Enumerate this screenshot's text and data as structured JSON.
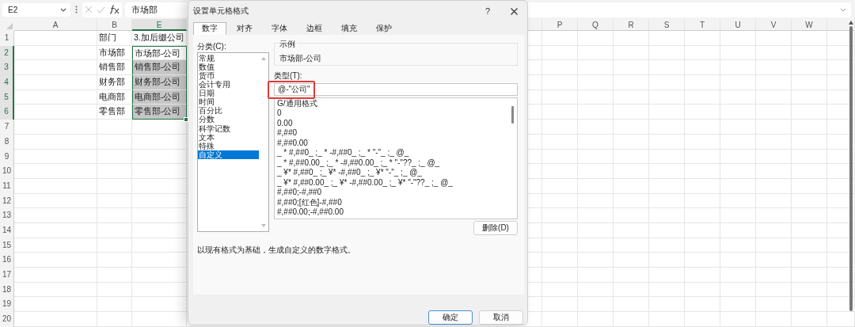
{
  "formula_bar": {
    "name_box": "E2",
    "formula": "市场部"
  },
  "sheet": {
    "columns_left": [
      {
        "label": "A",
        "selected": false
      },
      {
        "label": "B",
        "selected": false
      },
      {
        "label": "E",
        "selected": true
      }
    ],
    "columns_right": [
      {
        "label": "P",
        "selected": false
      },
      {
        "label": "Q",
        "selected": false
      },
      {
        "label": "R",
        "selected": false
      },
      {
        "label": "S",
        "selected": false
      },
      {
        "label": "T",
        "selected": false
      },
      {
        "label": "U",
        "selected": false
      },
      {
        "label": "V",
        "selected": false
      },
      {
        "label": "W",
        "selected": false
      }
    ],
    "rows": [
      {
        "number": "1",
        "selected": false,
        "active": false,
        "b": "部门",
        "e": "3.加后缀公司"
      },
      {
        "number": "2",
        "selected": true,
        "active": true,
        "b": "市场部",
        "e": "市场部-公司"
      },
      {
        "number": "3",
        "selected": true,
        "active": false,
        "b": "销售部",
        "e": "销售部-公司"
      },
      {
        "number": "4",
        "selected": true,
        "active": false,
        "b": "财务部",
        "e": "财务部-公司"
      },
      {
        "number": "5",
        "selected": true,
        "active": false,
        "b": "电商部",
        "e": "电商部-公司"
      },
      {
        "number": "6",
        "selected": true,
        "active": false,
        "b": "零售部",
        "e": "零售部-公司"
      },
      {
        "number": "7",
        "selected": false,
        "active": false
      },
      {
        "number": "8",
        "selected": false,
        "active": false
      },
      {
        "number": "9",
        "selected": false,
        "active": false
      },
      {
        "number": "10",
        "selected": false,
        "active": false
      },
      {
        "number": "11",
        "selected": false,
        "active": false
      },
      {
        "number": "12",
        "selected": false,
        "active": false
      },
      {
        "number": "13",
        "selected": false,
        "active": false
      },
      {
        "number": "14",
        "selected": false,
        "active": false
      },
      {
        "number": "15",
        "selected": false,
        "active": false
      },
      {
        "number": "16",
        "selected": false,
        "active": false
      },
      {
        "number": "17",
        "selected": false,
        "active": false
      },
      {
        "number": "18",
        "selected": false,
        "active": false
      },
      {
        "number": "19",
        "selected": false,
        "active": false
      },
      {
        "number": "20",
        "selected": false,
        "active": false
      }
    ]
  },
  "dialog": {
    "title": "设置单元格格式",
    "help": "?",
    "tabs": [
      {
        "label": "数字",
        "selected": true
      },
      {
        "label": "对齐",
        "selected": false
      },
      {
        "label": "字体",
        "selected": false
      },
      {
        "label": "边框",
        "selected": false
      },
      {
        "label": "填充",
        "selected": false
      },
      {
        "label": "保护",
        "selected": false
      }
    ],
    "category_label": "分类(C):",
    "categories": [
      {
        "label": "常规",
        "selected": false
      },
      {
        "label": "数值",
        "selected": false
      },
      {
        "label": "货币",
        "selected": false
      },
      {
        "label": "会计专用",
        "selected": false
      },
      {
        "label": "日期",
        "selected": false
      },
      {
        "label": "时间",
        "selected": false
      },
      {
        "label": "百分比",
        "selected": false
      },
      {
        "label": "分数",
        "selected": false
      },
      {
        "label": "科学记数",
        "selected": false
      },
      {
        "label": "文本",
        "selected": false
      },
      {
        "label": "特殊",
        "selected": false
      },
      {
        "label": "自定义",
        "selected": true
      }
    ],
    "sample_label": "示例",
    "sample_value": "市场部-公司",
    "type_label": "类型(T):",
    "type_value": "@-\"公司\"",
    "type_highlighted": true,
    "formats": [
      "G/通用格式",
      "0",
      "0.00",
      "#,##0",
      "#,##0.00",
      "_ * #,##0_ ;_ * -#,##0_ ;_ * \"-\"_ ;_ @_",
      "_ * #,##0.00_ ;_ * -#,##0.00_ ;_ * \"-\"??_ ;_ @_",
      "_ ¥* #,##0_ ;_ ¥* -#,##0_ ;_ ¥* \"-\"_ ;_ @_",
      "_ ¥* #,##0.00_ ;_ ¥* -#,##0.00_ ;_ ¥* \"-\"??_ ;_ @_",
      "#,##0;-#,##0",
      "#,##0;[红色]-#,##0",
      "#,##0.00;-#,##0.00"
    ],
    "delete_button": "删除(D)",
    "description": "以现有格式为基础，生成自定义的数字格式。",
    "buttons": [
      {
        "label": "确定",
        "kind": "primary"
      },
      {
        "label": "取消",
        "kind": "normal"
      }
    ]
  }
}
